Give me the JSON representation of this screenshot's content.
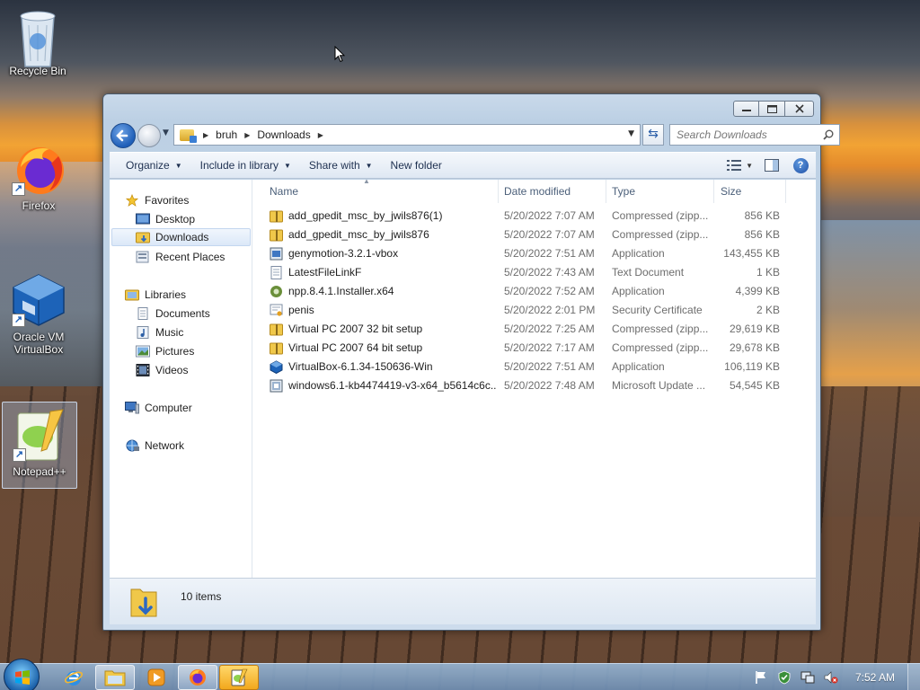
{
  "desktop": {
    "icons": [
      {
        "label": "Recycle Bin",
        "icon": "recycle-bin-icon"
      },
      {
        "label": "Firefox",
        "icon": "firefox-icon"
      },
      {
        "label": "Oracle VM VirtualBox",
        "icon": "virtualbox-icon"
      },
      {
        "label": "Notepad++",
        "icon": "notepadpp-icon"
      }
    ]
  },
  "window": {
    "controls": {
      "minimize": "minimize-icon",
      "maximize": "maximize-icon",
      "close": "close-icon"
    },
    "address": {
      "crumbs": [
        "bruh",
        "Downloads"
      ]
    },
    "search": {
      "placeholder": "Search Downloads"
    },
    "toolbar": {
      "organize": "Organize",
      "include_in_library": "Include in library",
      "share_with": "Share with",
      "new_folder": "New folder"
    },
    "nav": {
      "favorites": "Favorites",
      "desktop": "Desktop",
      "downloads": "Downloads",
      "recent_places": "Recent Places",
      "libraries": "Libraries",
      "documents": "Documents",
      "music": "Music",
      "pictures": "Pictures",
      "videos": "Videos",
      "computer": "Computer",
      "network": "Network"
    },
    "columns": {
      "name": "Name",
      "date": "Date modified",
      "type": "Type",
      "size": "Size"
    },
    "files": [
      {
        "name": "add_gpedit_msc_by_jwils876(1)",
        "date": "5/20/2022 7:07 AM",
        "type": "Compressed (zipp...",
        "size": "856 KB",
        "icon": "zip-folder-icon"
      },
      {
        "name": "add_gpedit_msc_by_jwils876",
        "date": "5/20/2022 7:07 AM",
        "type": "Compressed (zipp...",
        "size": "856 KB",
        "icon": "zip-folder-icon"
      },
      {
        "name": "genymotion-3.2.1-vbox",
        "date": "5/20/2022 7:51 AM",
        "type": "Application",
        "size": "143,455 KB",
        "icon": "installer-icon"
      },
      {
        "name": "LatestFileLinkF",
        "date": "5/20/2022 7:43 AM",
        "type": "Text Document",
        "size": "1 KB",
        "icon": "text-file-icon"
      },
      {
        "name": "npp.8.4.1.Installer.x64",
        "date": "5/20/2022 7:52 AM",
        "type": "Application",
        "size": "4,399 KB",
        "icon": "notepadpp-installer-icon"
      },
      {
        "name": "penis",
        "date": "5/20/2022 2:01 PM",
        "type": "Security Certificate",
        "size": "2 KB",
        "icon": "certificate-icon"
      },
      {
        "name": "Virtual PC 2007 32 bit setup",
        "date": "5/20/2022 7:25 AM",
        "type": "Compressed (zipp...",
        "size": "29,619 KB",
        "icon": "zip-folder-icon"
      },
      {
        "name": "Virtual PC 2007 64 bit setup",
        "date": "5/20/2022 7:17 AM",
        "type": "Compressed (zipp...",
        "size": "29,678 KB",
        "icon": "zip-folder-icon"
      },
      {
        "name": "VirtualBox-6.1.34-150636-Win",
        "date": "5/20/2022 7:51 AM",
        "type": "Application",
        "size": "106,119 KB",
        "icon": "virtualbox-installer-icon"
      },
      {
        "name": "windows6.1-kb4474419-v3-x64_b5614c6c...",
        "date": "5/20/2022 7:48 AM",
        "type": "Microsoft Update ...",
        "size": "54,545 KB",
        "icon": "msu-file-icon"
      }
    ],
    "status": {
      "count": "10 items"
    }
  },
  "taskbar": {
    "apps": [
      "ie-icon",
      "explorer-icon",
      "media-player-icon",
      "firefox-icon",
      "notepadpp-icon"
    ],
    "clock": "7:52 AM"
  },
  "colors": {
    "accent": "#1f5fb8",
    "selection": "#dbe8f8",
    "folder": "#f0c84a"
  }
}
